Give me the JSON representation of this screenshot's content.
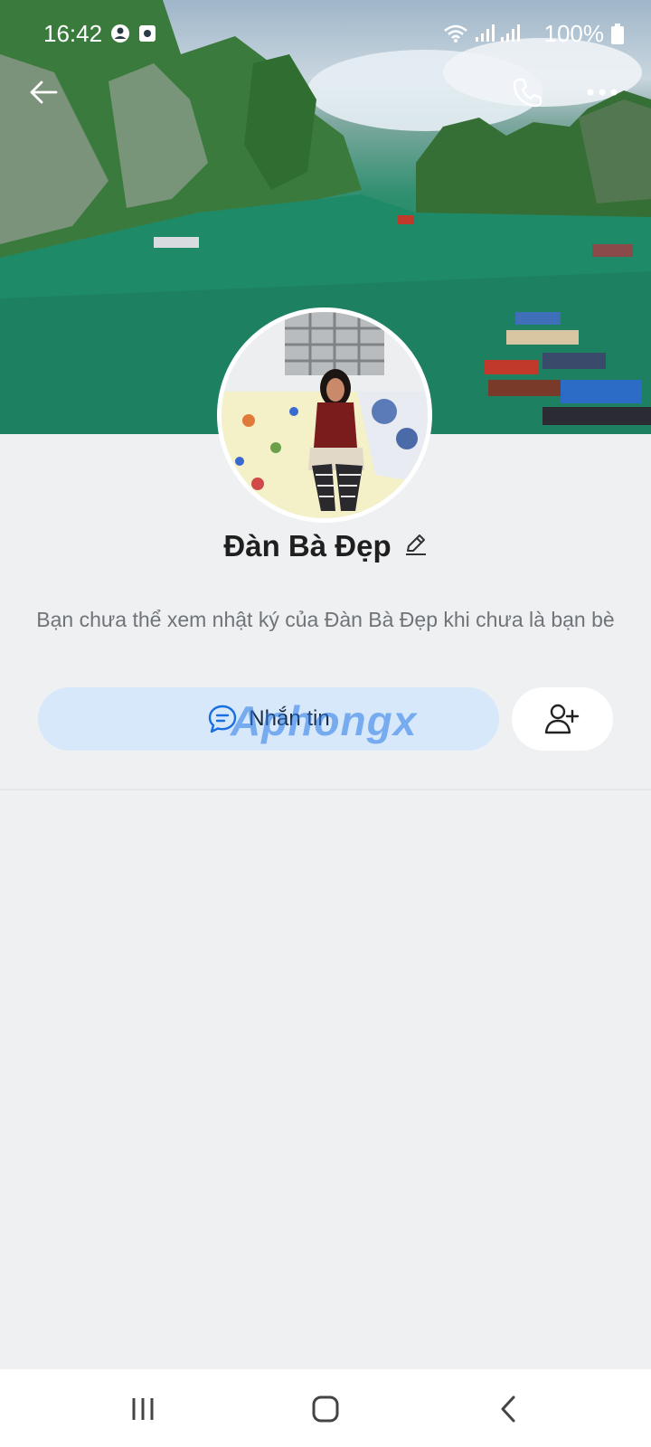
{
  "status_bar": {
    "time": "16:42",
    "battery": "100%"
  },
  "profile": {
    "name": "Đàn Bà Đẹp",
    "notice": "Bạn chưa thể xem nhật ký của Đàn Bà Đẹp khi chưa là bạn bè"
  },
  "actions": {
    "message_label": "Nhắn tin"
  },
  "watermark": "Aphongx",
  "icons": {
    "back": "back-arrow-icon",
    "call": "phone-icon",
    "more": "more-dots-icon",
    "edit": "pencil-icon",
    "chat": "chat-bubble-icon",
    "add_friend": "add-friend-icon",
    "recents": "recents-icon",
    "home": "home-icon",
    "nav_back": "nav-back-icon"
  },
  "colors": {
    "background": "#eef0f2",
    "message_button": "#d7e8fb",
    "accent": "#1a6fe0"
  }
}
